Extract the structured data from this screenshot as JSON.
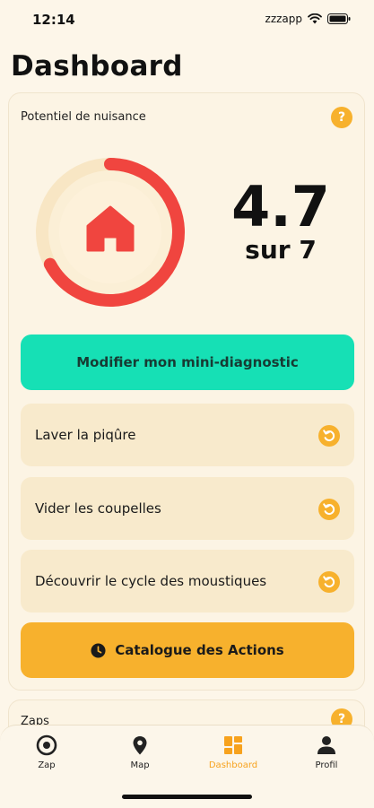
{
  "status_bar": {
    "time": "12:14",
    "carrier": "zzzapp"
  },
  "page_title": "Dashboard",
  "nuisance_card": {
    "label": "Potentiel de nuisance",
    "help": "?",
    "score": "4.7",
    "score_sub": "sur 7",
    "gauge_fraction": 0.672
  },
  "primary_button": "Modifier mon mini-diagnostic",
  "actions": [
    {
      "label": "Laver la piqûre"
    },
    {
      "label": "Vider les coupelles"
    },
    {
      "label": "Découvrir le cycle des moustiques"
    }
  ],
  "catalogue_button": "Catalogue des Actions",
  "zaps_card": {
    "label": "Zaps",
    "help": "?"
  },
  "tabs": [
    {
      "label": "Zap",
      "icon": "target-icon",
      "active": false
    },
    {
      "label": "Map",
      "icon": "map-pin-icon",
      "active": false
    },
    {
      "label": "Dashboard",
      "icon": "dashboard-icon",
      "active": true
    },
    {
      "label": "Profil",
      "icon": "user-icon",
      "active": false
    }
  ],
  "colors": {
    "accent_teal": "#16E0B5",
    "accent_orange": "#F7B12D",
    "gauge_red": "#F0453F",
    "background": "#FDF6E9"
  }
}
